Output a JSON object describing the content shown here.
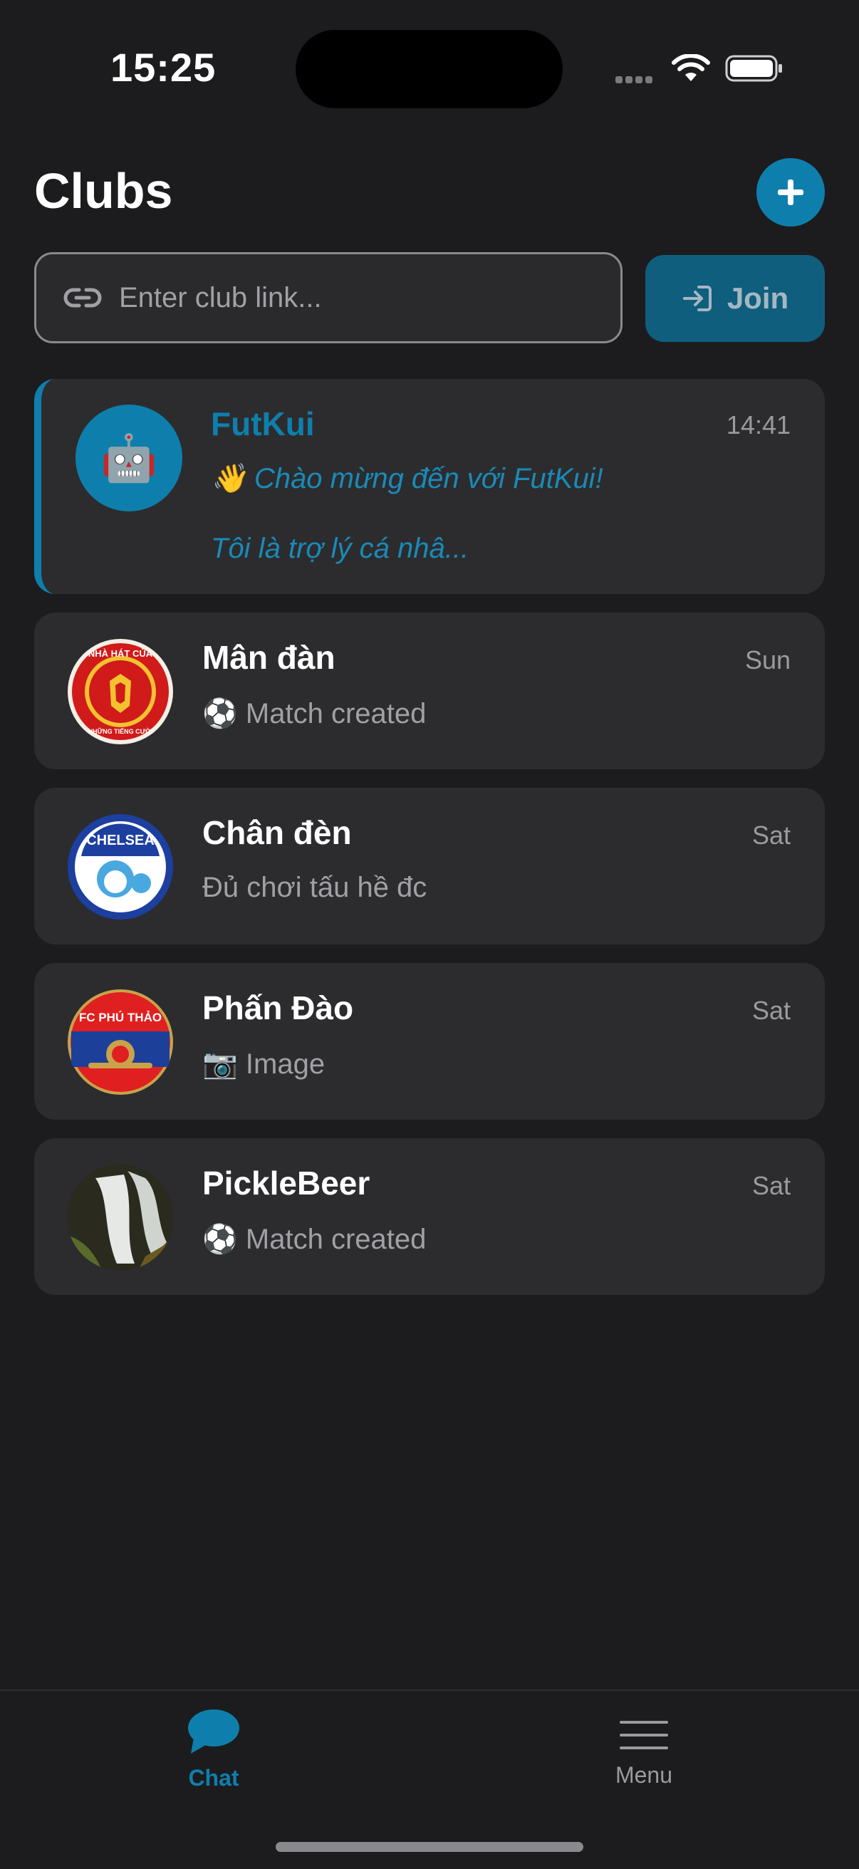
{
  "status_bar": {
    "time": "15:25"
  },
  "header": {
    "title": "Clubs",
    "add_button_label": "+"
  },
  "join_row": {
    "placeholder": "Enter club link...",
    "join_label": "Join"
  },
  "chats": [
    {
      "name": "FutKui",
      "time": "14:41",
      "preview_line1": "👋 Chào mừng đến với FutKui!",
      "preview_line2": "Tôi là trợ lý cá nhâ...",
      "avatar": "robot-emoji",
      "highlight": true,
      "avatar_emoji": "🤖"
    },
    {
      "name": "Mân đàn",
      "time": "Sun",
      "preview": "⚽ Match created",
      "avatar": "man-utd-style-crest"
    },
    {
      "name": "Chân đèn",
      "time": "Sat",
      "preview": "Đủ chơi tấu hề đc",
      "avatar": "chelsea-style-crest"
    },
    {
      "name": "Phấn Đào",
      "time": "Sat",
      "preview": "📷 Image",
      "avatar": "arsenal-style-crest"
    },
    {
      "name": "PickleBeer",
      "time": "Sat",
      "preview": "⚽ Match created",
      "avatar": "waterfall-photo"
    }
  ],
  "crests": {
    "man_utd": {
      "ring_top": "NHÀ HÁT CỦA",
      "ring_bottom": "NHỮNG TIẾNG CƯỜI"
    },
    "chelsea": {
      "text": "CHELSEA"
    },
    "arsenal": {
      "text": "FC PHÚ THẢO"
    }
  },
  "tabs": [
    {
      "label": "Chat",
      "icon": "chat-bubble-icon",
      "active": true
    },
    {
      "label": "Menu",
      "icon": "hamburger-icon",
      "active": false
    }
  ],
  "colors": {
    "accent": "#0e7fac",
    "background": "#1c1c1e",
    "card": "#2c2c2e"
  }
}
